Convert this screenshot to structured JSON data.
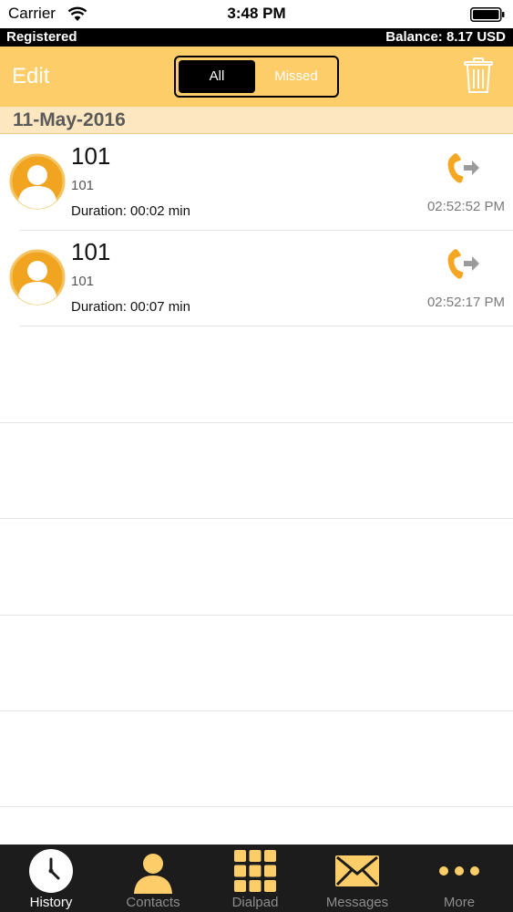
{
  "status_bar": {
    "carrier": "Carrier",
    "time": "3:48 PM",
    "wifi_icon": "wifi-icon",
    "battery_icon": "battery-icon"
  },
  "account_bar": {
    "status": "Registered",
    "balance": "Balance: 8.17 USD"
  },
  "toolbar": {
    "edit_label": "Edit",
    "segments": [
      "All",
      "Missed"
    ],
    "selected_segment": "All",
    "delete_icon": "trash-icon"
  },
  "colors": {
    "accent": "#fdcd6a",
    "header_bg": "#fce7c0",
    "tabbar_bg": "#1c1c1c",
    "icon_orange": "#f5a623"
  },
  "history": {
    "date": "11-May-2016",
    "calls": [
      {
        "name": "101",
        "number": "101",
        "duration": "Duration: 00:02 min",
        "time": "02:52:52 PM",
        "direction_icon": "outgoing-call-icon"
      },
      {
        "name": "101",
        "number": "101",
        "duration": "Duration: 00:07 min",
        "time": "02:52:17 PM",
        "direction_icon": "outgoing-call-icon"
      }
    ]
  },
  "tabbar": {
    "active": "History",
    "tabs": [
      {
        "label": "History",
        "icon": "clock-icon"
      },
      {
        "label": "Contacts",
        "icon": "person-icon"
      },
      {
        "label": "Dialpad",
        "icon": "dialpad-icon"
      },
      {
        "label": "Messages",
        "icon": "envelope-icon"
      },
      {
        "label": "More",
        "icon": "more-dots-icon"
      }
    ]
  }
}
